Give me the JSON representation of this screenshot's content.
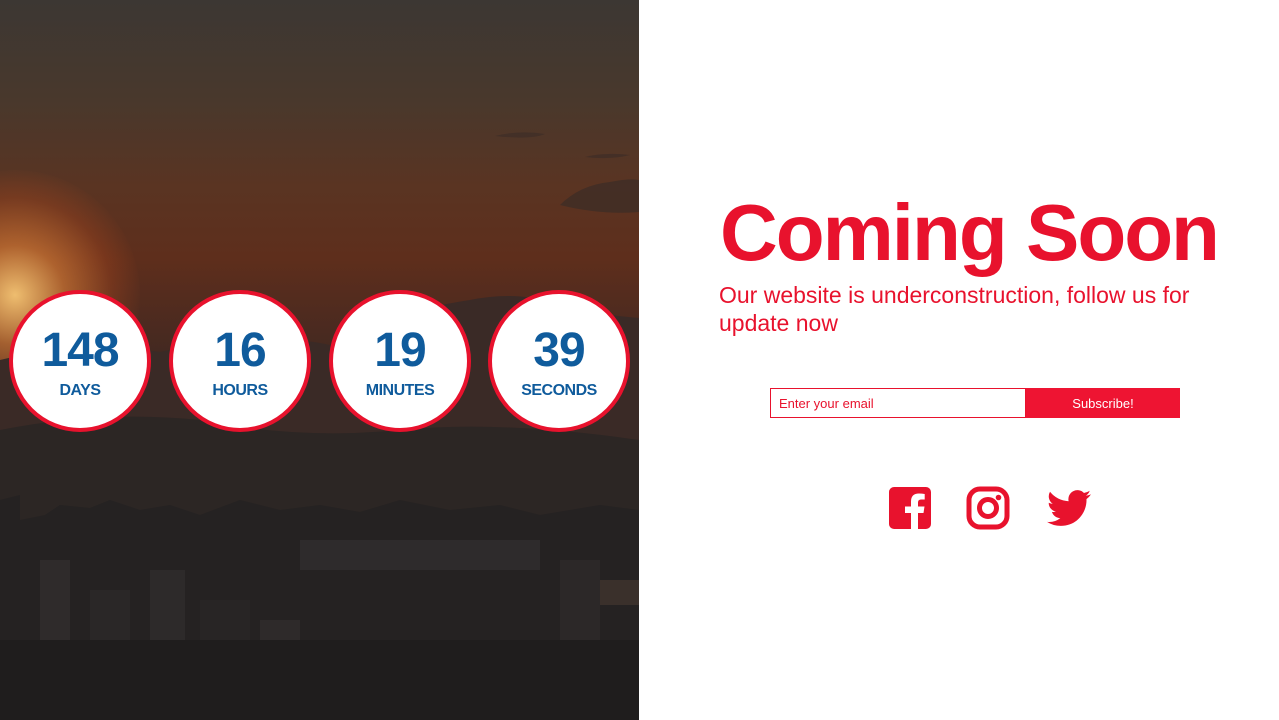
{
  "countdown": {
    "days": {
      "value": "148",
      "label": "DAYS"
    },
    "hours": {
      "value": "16",
      "label": "HOURS"
    },
    "minutes": {
      "value": "19",
      "label": "MINUTES"
    },
    "seconds": {
      "value": "39",
      "label": "SECONDS"
    }
  },
  "heading": "Coming Soon",
  "subtitle": "Our website is underconstruction, follow us for update now",
  "subscribe": {
    "placeholder": "Enter your email",
    "button_label": "Subscribe!"
  },
  "social": [
    {
      "name": "facebook-icon"
    },
    {
      "name": "instagram-icon"
    },
    {
      "name": "twitter-icon"
    }
  ],
  "colors": {
    "accent": "#e8122d",
    "counter_text": "#0f5b9c",
    "background": "#ffffff"
  }
}
